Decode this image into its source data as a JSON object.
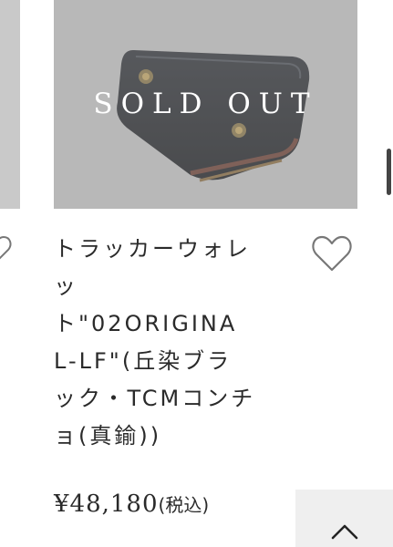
{
  "product": {
    "status_label": "SOLD OUT",
    "title_lines": [
      "トラッカーウォレ",
      "ッ",
      "ト\"02ORIGINA",
      "L-LF\"(丘染ブラ",
      "ック・TCMコンチ",
      "ョ(真鍮))"
    ],
    "price": "¥48,180",
    "tax_note": "(税込)"
  },
  "icons": {
    "favorite": "heart-outline-icon",
    "back_to_top": "chevron-up-icon"
  }
}
